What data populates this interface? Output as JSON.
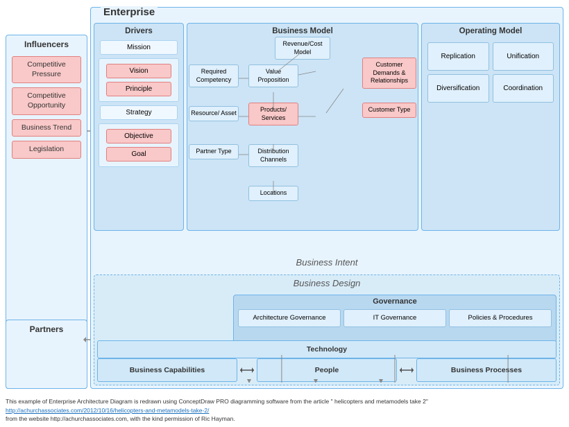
{
  "enterprise": {
    "label": "Enterprise",
    "sections": {
      "drivers": {
        "title": "Drivers",
        "items": [
          "Mission",
          "Vision",
          "Principle",
          "Strategy",
          "Objective",
          "Goal"
        ]
      },
      "businessModel": {
        "title": "Business Model",
        "items": [
          "Revenue/Cost Model",
          "Required Competency",
          "Value Proposition",
          "Customer Demands & Relationships",
          "Resource/ Asset",
          "Products/ Services",
          "Customer Type",
          "Partner Type",
          "Distribution Channels",
          "Locations"
        ]
      },
      "operatingModel": {
        "title": "Operating Model",
        "items": [
          "Replication",
          "Unification",
          "Diversification",
          "Coordination"
        ]
      }
    },
    "businessIntent": "Business Intent",
    "businessDesign": {
      "label": "Business Design",
      "governance": {
        "title": "Governance",
        "items": [
          "Architecture Governance",
          "IT Governance",
          "Policies & Procedures"
        ]
      },
      "bottomRow": [
        "Business Capabilities",
        "People",
        "Business Processes"
      ],
      "technology": "Technology"
    }
  },
  "influencers": {
    "title": "Influencers",
    "items": [
      "Competitive Pressure",
      "Competitive Opportunity",
      "Business Trend",
      "Legislation"
    ]
  },
  "partners": {
    "title": "Partners"
  },
  "footer": {
    "line1": "This example of Enterprise Architecture Diagram is redrawn using ConceptDraw PRO diagramming software  from the article \" helicopters and metamodels take 2\"",
    "link": "http://achurchassociates.com/2012/10/16/helicopters-and-metamodels-take-2/",
    "line2": "from the website http://achurchassociates.com,  with the kind permission of Ric Hayman."
  }
}
